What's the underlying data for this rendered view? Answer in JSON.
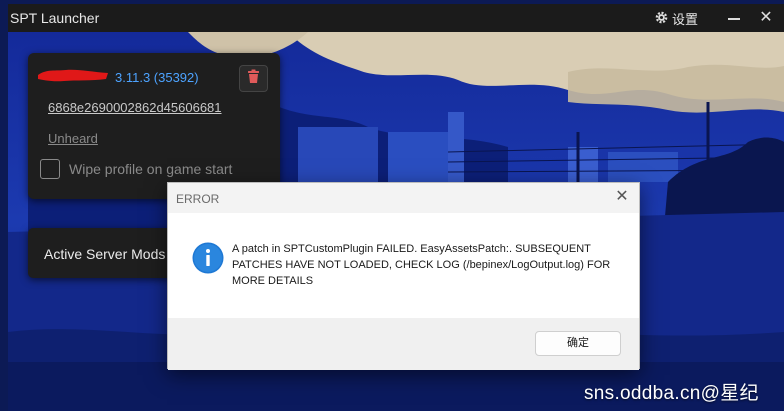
{
  "app": {
    "title": "SPT Launcher",
    "settings_label": "设置",
    "close_glyph": "✕"
  },
  "profile": {
    "version": "3.11.3 (35392)",
    "profile_id": "6868e2690002862d45606681",
    "edition": "Unheard",
    "wipe_label": "Wipe profile on game start",
    "wipe_checked": false
  },
  "mods": {
    "label": "Active Server Mods"
  },
  "dialog": {
    "title": "ERROR",
    "message": "A patch in SPTCustomPlugin FAILED. EasyAssetsPatch:. SUBSEQUENT PATCHES HAVE NOT LOADED, CHECK LOG (/bepinex/LogOutput.log) FOR MORE DETAILS",
    "ok_label": "确定",
    "close_glyph": "✕",
    "icon": "info-icon"
  },
  "watermark": "sns.oddba.cn@星纪",
  "colors": {
    "accent_link": "#4da3ff",
    "delete_icon": "#e05a5a",
    "info_icon": "#1e78d4"
  }
}
